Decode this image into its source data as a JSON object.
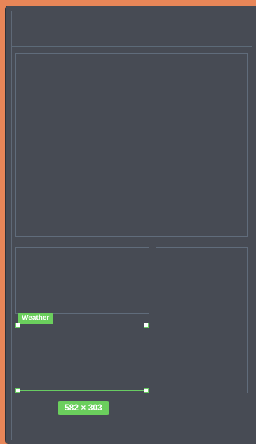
{
  "selection": {
    "layer_name": "Weather",
    "dimensions": "582 × 303"
  },
  "colors": {
    "background_accent": "#e88658",
    "canvas": "#474b54",
    "outline": "#606c7b",
    "selection": "#6bcf5d"
  }
}
